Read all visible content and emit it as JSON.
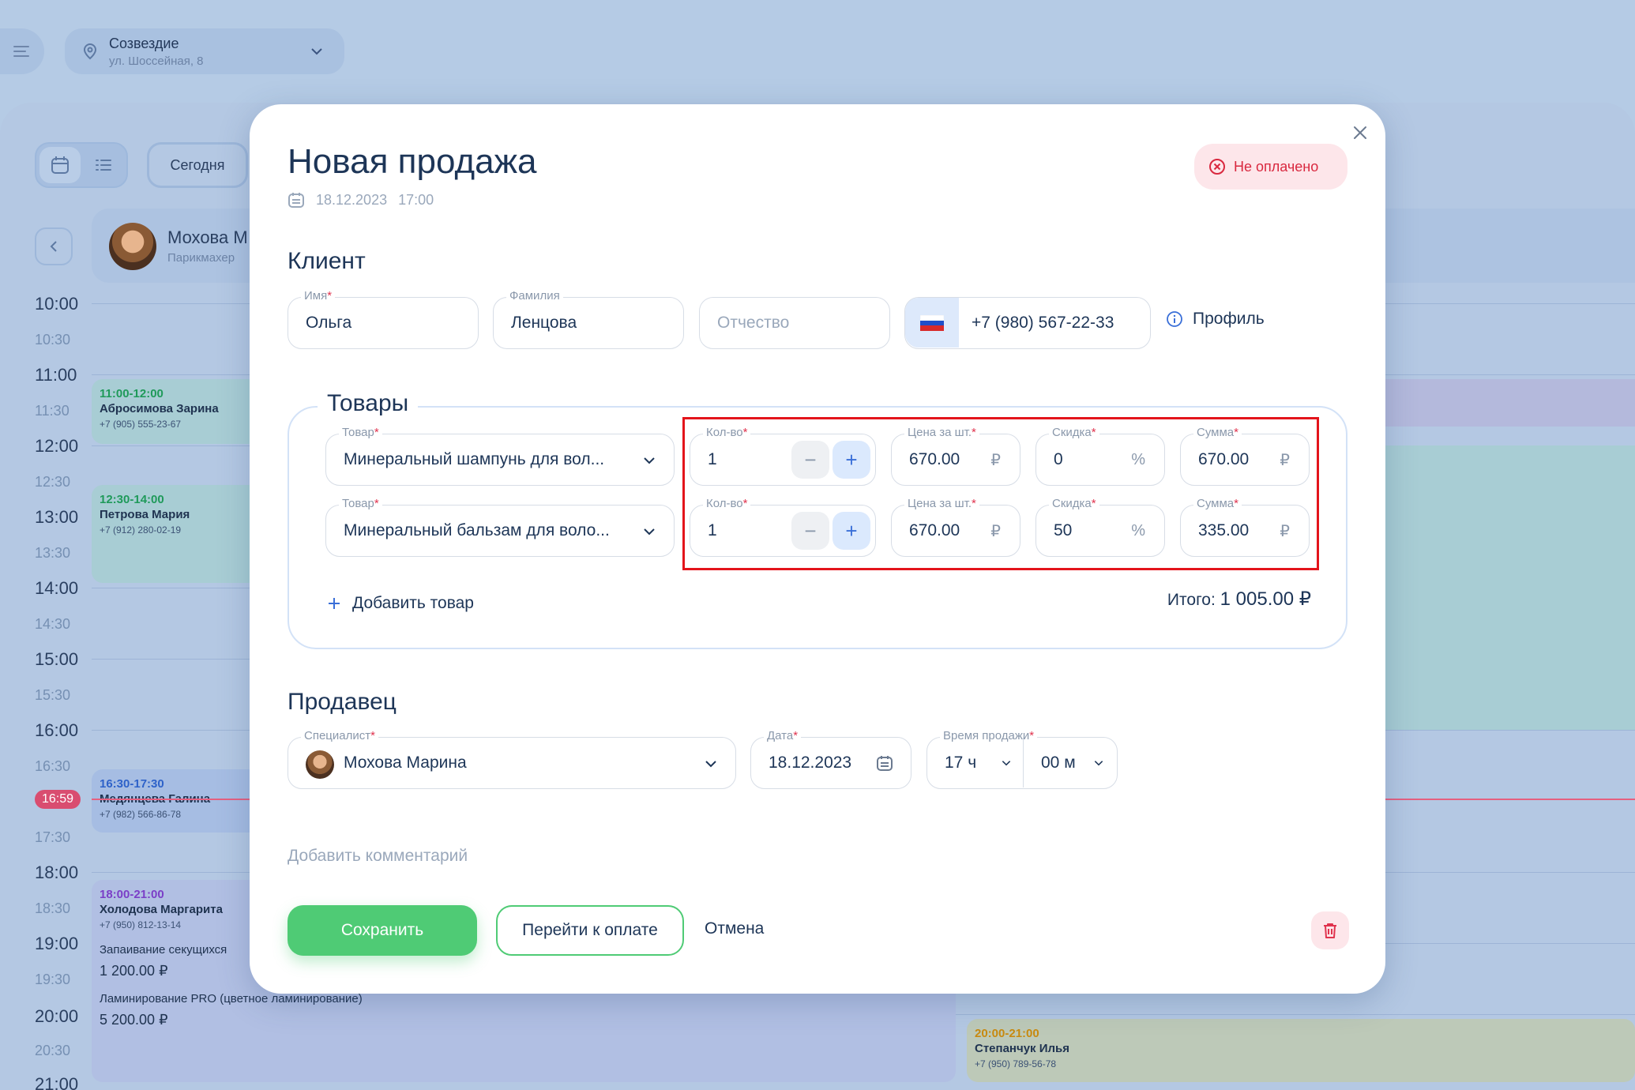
{
  "location": {
    "name": "Созвездие",
    "address": "ул. Шоссейная, 8"
  },
  "toolbar": {
    "today_label": "Сегодня"
  },
  "staff": {
    "name": "Мохова М",
    "role": "Парикмахер"
  },
  "timeline": [
    "10:00",
    "10:30",
    "11:00",
    "11:30",
    "12:00",
    "12:30",
    "13:00",
    "13:30",
    "14:00",
    "14:30",
    "15:00",
    "15:30",
    "16:00",
    "16:30",
    "17:30",
    "18:00",
    "18:30",
    "19:00",
    "19:30",
    "20:00",
    "20:30",
    "21:00"
  ],
  "now_time": "16:59",
  "appointments": [
    {
      "time": "11:00-12:00",
      "name": "Абросимова Зарина",
      "phone": "+7 (905) 555-23-67"
    },
    {
      "time": "12:30-14:00",
      "name": "Петрова Мария",
      "phone": "+7 (912) 280-02-19"
    },
    {
      "time": "16:30-17:30",
      "name": "Медянцева Галина",
      "phone": "+7 (982) 566-86-78"
    },
    {
      "time": "18:00-21:00",
      "name": "Холодова Маргарита",
      "phone": "+7 (950) 812-13-14",
      "service1": "Запаивание секущихся",
      "price1": "1 200.00 ₽",
      "service2": "Ламинирование PRO (цветное ламинирование)",
      "price2": "5 200.00 ₽"
    },
    {
      "time": "20:00-21:00",
      "name": "Степанчук Илья",
      "phone": "+7 (950) 789-56-78"
    }
  ],
  "modal": {
    "title": "Новая продажа",
    "date": "18.12.2023",
    "time": "17:00",
    "status": "Не оплачено",
    "client_section": "Клиент",
    "client": {
      "first_name_label": "Имя",
      "first_name": "Ольга",
      "last_name_label": "Фамилия",
      "last_name": "Ленцова",
      "patronymic_placeholder": "Отчество",
      "phone": "+7 (980) 567-22-33",
      "profile_label": "Профиль"
    },
    "goods_section": "Товары",
    "goods_labels": {
      "product": "Товар",
      "qty": "Кол-во",
      "price": "Цена за шт.",
      "discount": "Скидка",
      "sum": "Сумма",
      "currency": "₽",
      "percent": "%"
    },
    "goods": [
      {
        "product": "Минеральный шампунь для вол...",
        "qty": "1",
        "price": "670.00",
        "discount": "0",
        "sum": "670.00"
      },
      {
        "product": "Минеральный бальзам для воло...",
        "qty": "1",
        "price": "670.00",
        "discount": "50",
        "sum": "335.00"
      }
    ],
    "add_good": "Добавить товар",
    "total_label": "Итого:",
    "total_value": "1 005.00 ₽",
    "seller_section": "Продавец",
    "seller": {
      "specialist_label": "Специалист",
      "specialist": "Мохова Марина",
      "date_label": "Дата",
      "date": "18.12.2023",
      "time_label": "Время продажи",
      "hours": "17 ч",
      "minutes": "00 м"
    },
    "comment_placeholder": "Добавить комментарий",
    "save": "Сохранить",
    "to_payment": "Перейти к оплате",
    "cancel": "Отмена"
  },
  "colors": {
    "accent_green": "#4fcb75",
    "danger": "#d9283f",
    "highlight": "#e3141b"
  }
}
